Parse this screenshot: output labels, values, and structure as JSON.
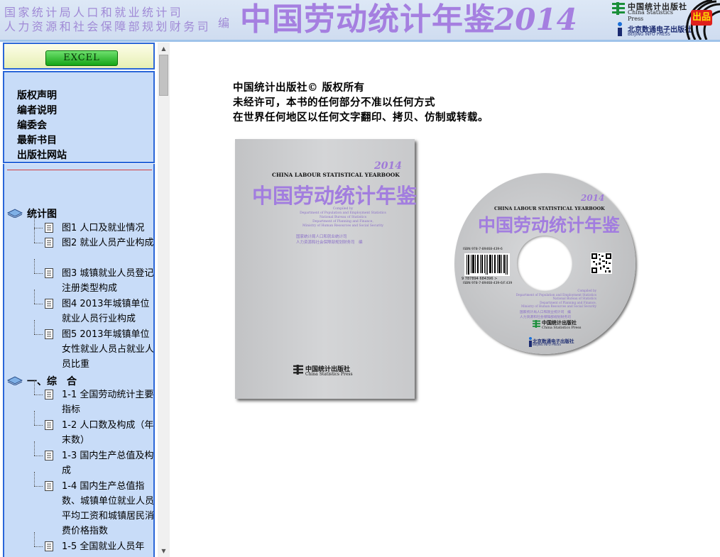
{
  "header": {
    "org_line1": "国家统计局人口和就业统计司",
    "org_line2": "人力资源和社会保障部规划财务司",
    "bian": "编",
    "title": "中国劳动统计年鉴",
    "year": "2014",
    "publisher_cn": "中国统计出版社",
    "publisher_en": "China Statistics Press",
    "epub_cn": "北京数通电子出版社",
    "epub_en": "BEIJING INFO PRESS",
    "badge": "出品",
    "colors": {
      "title": "#a57fe0",
      "bg": "#dde8f6"
    }
  },
  "sidebar": {
    "excel_label": "EXCEL",
    "links": [
      "版权声明",
      "编者说明",
      "编委会",
      "最新书目",
      "出版社网站"
    ],
    "tree": [
      {
        "type": "root",
        "label": "统计图",
        "icon": "book-icon"
      },
      {
        "type": "leaf",
        "label": "图1 人口及就业情况",
        "icon": "page-icon"
      },
      {
        "type": "leaf",
        "label": "图2 就业人员产业构成",
        "icon": "page-icon"
      },
      {
        "type": "leaf",
        "label": "图3 城镇就业人员登记注册类型构成",
        "icon": "page-icon"
      },
      {
        "type": "leaf",
        "label": "图4 2013年城镇单位就业人员行业构成",
        "icon": "page-icon"
      },
      {
        "type": "leaf",
        "label": "图5 2013年城镇单位女性就业人员占就业人员比重",
        "icon": "page-icon"
      },
      {
        "type": "root",
        "label": "一、综　合",
        "icon": "book-icon"
      },
      {
        "type": "leaf",
        "label": "1-1 全国劳动统计主要指标",
        "icon": "page-icon"
      },
      {
        "type": "leaf",
        "label": "1-2 人口数及构成（年末数）",
        "icon": "page-icon"
      },
      {
        "type": "leaf",
        "label": "1-3 国内生产总值及构成",
        "icon": "page-icon"
      },
      {
        "type": "leaf",
        "label": "1-4 国内生产总值指数、城镇单位就业人员平均工资和城镇居民消费价格指数",
        "icon": "page-icon"
      },
      {
        "type": "leaf",
        "label": "1-5 全国就业人员年",
        "icon": "page-icon"
      }
    ]
  },
  "main": {
    "copyright": [
      "中国统计出版社© 版权所有",
      "未经许可，本书的任何部分不准以任何方式",
      "在世界任何地区以任何文字翻印、拷贝、仿制或转载。"
    ],
    "book": {
      "year": "2014",
      "en_title": "CHINA LABOUR STATISTICAL YEARBOOK",
      "cn_title": "中国劳动统计年鉴",
      "compiled": [
        "Compiled by",
        "Department of Population and Employment Statistics",
        "National Bureau of Statistics",
        "Department of Planning and Finance,",
        "Ministry of Human Resources and Social Security"
      ],
      "org": [
        "国家统计局人口和就业统计司",
        "人力资源和社会保障部规划财务司　编"
      ],
      "pub_cn": "中国统计出版社",
      "pub_en": "China Statistics Press"
    },
    "disc": {
      "year": "2014",
      "en_title": "CHINA LABOUR STATISTICAL YEARBOOK",
      "cn_title": "中国劳动统计年鉴",
      "isbn_top": "ISBN 978-7-89468-439-6",
      "isbn_num": "9 787894 684396 >",
      "isbn_bot": "ISBN 978-7-89468-439-6/F.439",
      "compiled": [
        "Compiled by",
        "Department of Population and Employment Statistics",
        "National Bureau of Statistics",
        "Department of Planning and Finance,",
        "Ministry of Human Resources and Social Security"
      ],
      "org": [
        "国家统计局人口和就业统计司　编",
        "人力资源和社会保障部规划财务司"
      ],
      "pub1_cn": "中国统计出版社",
      "pub1_en": "China Statistics Press",
      "pub2_cn": "北京数通电子出版社",
      "pub2_en": "BEIJING INFO PRESS"
    }
  }
}
